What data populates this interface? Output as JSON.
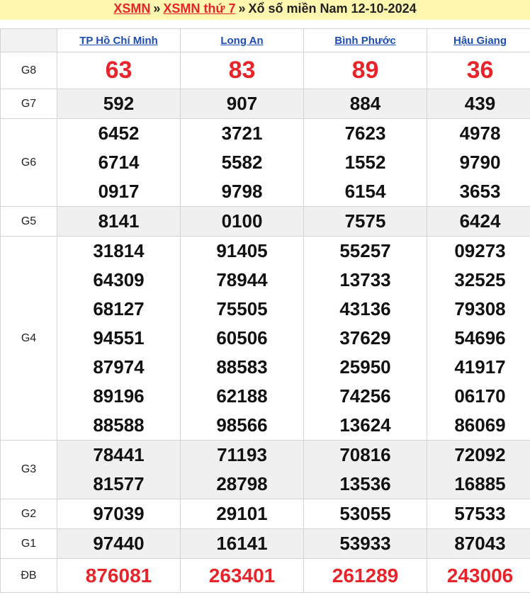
{
  "header": {
    "link1": "XSMN",
    "sep1": "»",
    "link2": "XSMN thứ 7",
    "sep2": "»",
    "title": "Xổ số miền Nam 12-10-2024"
  },
  "provinces": [
    "TP Hồ Chí Minh",
    "Long An",
    "Bình Phước",
    "Hậu Giang"
  ],
  "prizes": [
    {
      "label": "G8",
      "values": [
        [
          "63"
        ],
        [
          "83"
        ],
        [
          "89"
        ],
        [
          "36"
        ]
      ]
    },
    {
      "label": "G7",
      "values": [
        [
          "592"
        ],
        [
          "907"
        ],
        [
          "884"
        ],
        [
          "439"
        ]
      ]
    },
    {
      "label": "G6",
      "values": [
        [
          "6452",
          "6714",
          "0917"
        ],
        [
          "3721",
          "5582",
          "9798"
        ],
        [
          "7623",
          "1552",
          "6154"
        ],
        [
          "4978",
          "9790",
          "3653"
        ]
      ]
    },
    {
      "label": "G5",
      "values": [
        [
          "8141"
        ],
        [
          "0100"
        ],
        [
          "7575"
        ],
        [
          "6424"
        ]
      ]
    },
    {
      "label": "G4",
      "values": [
        [
          "31814",
          "64309",
          "68127",
          "94551",
          "87974",
          "89196",
          "88588"
        ],
        [
          "91405",
          "78944",
          "75505",
          "60506",
          "88583",
          "62188",
          "98566"
        ],
        [
          "55257",
          "13733",
          "43136",
          "37629",
          "25950",
          "74256",
          "13624"
        ],
        [
          "09273",
          "32525",
          "79308",
          "54696",
          "41917",
          "06170",
          "86069"
        ]
      ]
    },
    {
      "label": "G3",
      "values": [
        [
          "78441",
          "81577"
        ],
        [
          "71193",
          "28798"
        ],
        [
          "70816",
          "13536"
        ],
        [
          "72092",
          "16885"
        ]
      ]
    },
    {
      "label": "G2",
      "values": [
        [
          "97039"
        ],
        [
          "29101"
        ],
        [
          "53055"
        ],
        [
          "57533"
        ]
      ]
    },
    {
      "label": "G1",
      "values": [
        [
          "97440"
        ],
        [
          "16141"
        ],
        [
          "53933"
        ],
        [
          "87043"
        ]
      ]
    },
    {
      "label": "ĐB",
      "values": [
        [
          "876081"
        ],
        [
          "263401"
        ],
        [
          "261289"
        ],
        [
          "243006"
        ]
      ]
    }
  ]
}
